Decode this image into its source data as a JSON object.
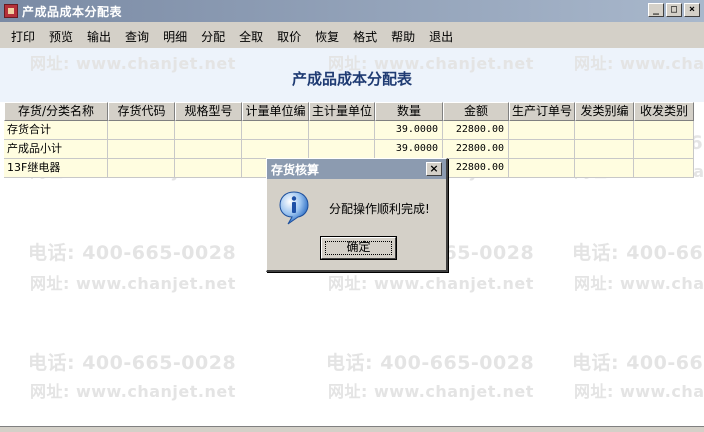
{
  "window": {
    "title": "产成品成本分配表",
    "buttons": {
      "minimize": "_",
      "maximize": "□",
      "close": "×"
    }
  },
  "menu": {
    "items": [
      "打印",
      "预览",
      "输出",
      "查询",
      "明细",
      "分配",
      "全取",
      "取价",
      "恢复",
      "格式",
      "帮助",
      "退出"
    ]
  },
  "report": {
    "title": "产成品成本分配表"
  },
  "watermark": {
    "phone": "电话: 400-665-0028",
    "url": "网址: www.chanjet.net"
  },
  "table": {
    "columns": [
      "存货/分类名称",
      "存货代码",
      "规格型号",
      "计量单位编",
      "主计量单位",
      "数量",
      "金额",
      "生产订单号",
      "发类别编",
      "收发类别"
    ],
    "rows": [
      [
        "存货合计",
        "",
        "",
        "",
        "",
        "39.0000",
        "22800.00",
        "",
        "",
        ""
      ],
      [
        "产成品小计",
        "",
        "",
        "",
        "",
        "39.0000",
        "22800.00",
        "",
        "",
        ""
      ],
      [
        "13F继电器",
        "",
        "",
        "",
        "",
        "",
        "22800.00",
        "",
        "",
        ""
      ]
    ]
  },
  "dialog": {
    "title": "存货核算",
    "message": "分配操作顺利完成!",
    "ok_label": "确定",
    "close": "×",
    "icon": "info-icon"
  },
  "colors": {
    "titlebar": "#7a8aa4",
    "row_bg": "#fffde0",
    "report_title": "#1f3b73",
    "header_bg": "#edf3fb"
  }
}
